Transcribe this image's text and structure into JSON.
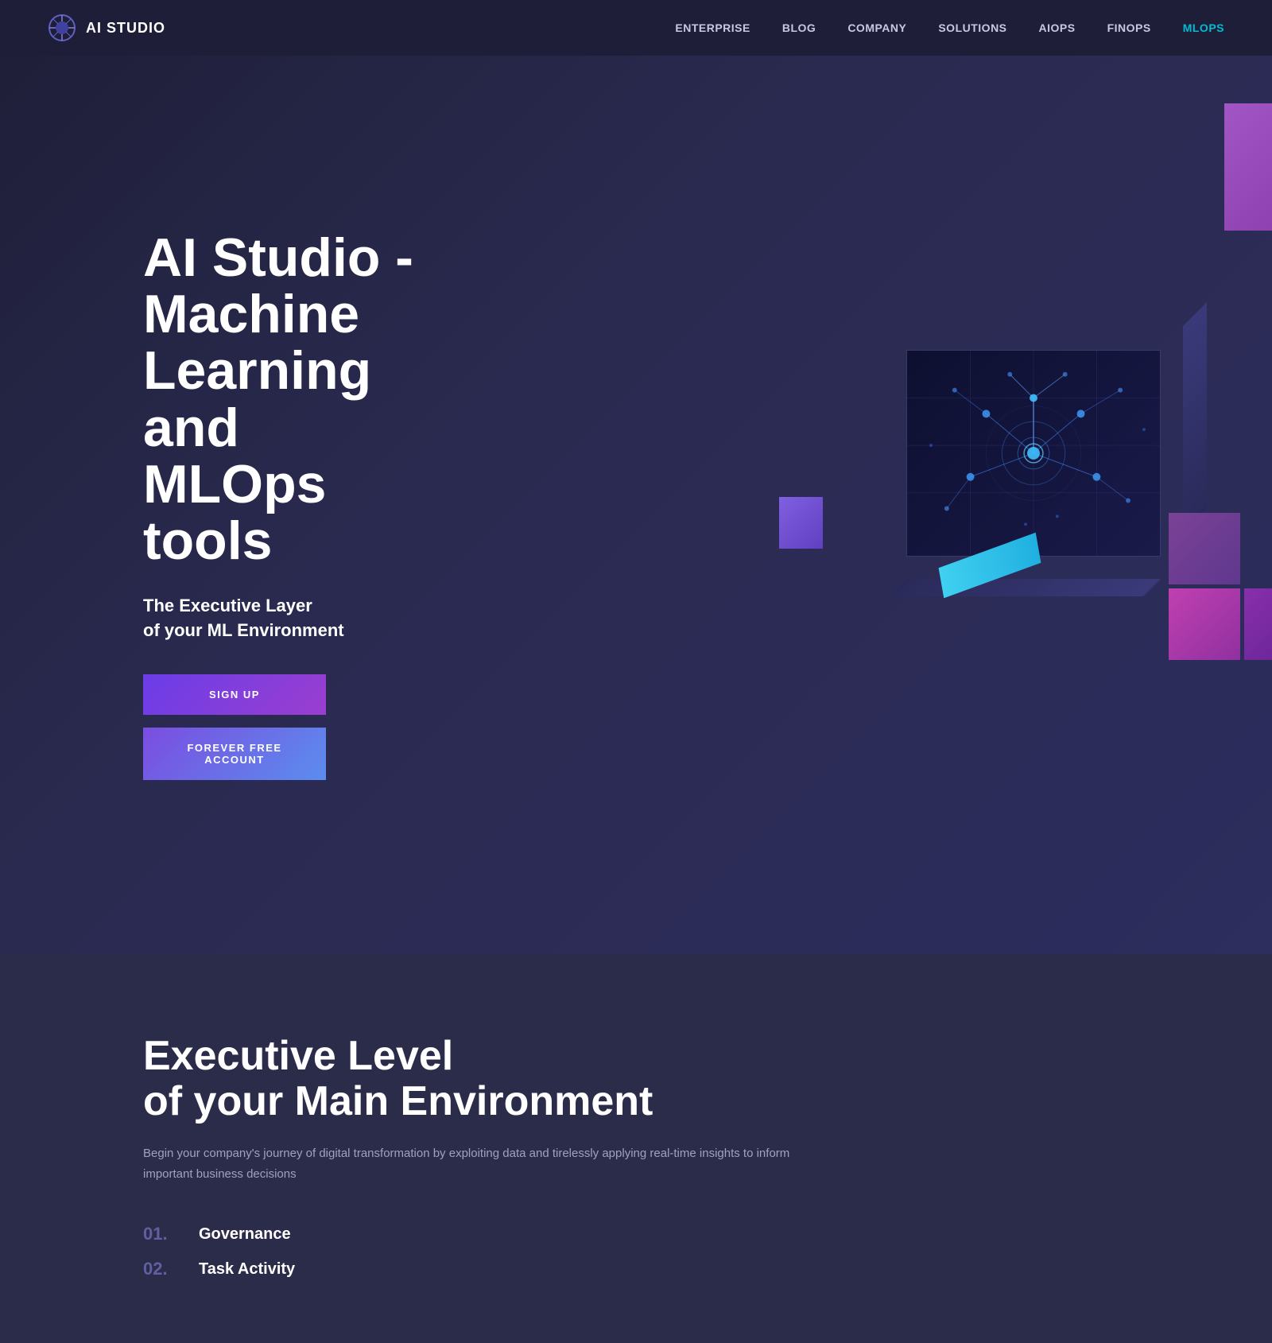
{
  "nav": {
    "logo_text": "AI STUDIO",
    "links": [
      {
        "label": "ENTERPRISE",
        "active": false
      },
      {
        "label": "BLOG",
        "active": false
      },
      {
        "label": "COMPANY",
        "active": false
      },
      {
        "label": "SOLUTIONS",
        "active": false
      },
      {
        "label": "AIOPS",
        "active": false
      },
      {
        "label": "FINOPS",
        "active": false
      },
      {
        "label": "MLOPS",
        "active": true
      }
    ]
  },
  "hero": {
    "title": "AI Studio - Machine Learning and MLOps tools",
    "subtitle_line1": "The Executive Layer",
    "subtitle_line2": "of your ML Environment",
    "btn_signup": "SIGN UP",
    "btn_free": "FOREVER FREE ACCOUNT"
  },
  "second_section": {
    "title_line1": "Executive Level",
    "title_line2": "of your Main Environment",
    "desc": "Begin your company's journey of digital transformation by exploiting data and tirelessly applying real-time insights to inform important business decisions",
    "features": [
      {
        "num": "01.",
        "label": "Governance"
      },
      {
        "num": "02.",
        "label": "Task Activity"
      }
    ]
  }
}
